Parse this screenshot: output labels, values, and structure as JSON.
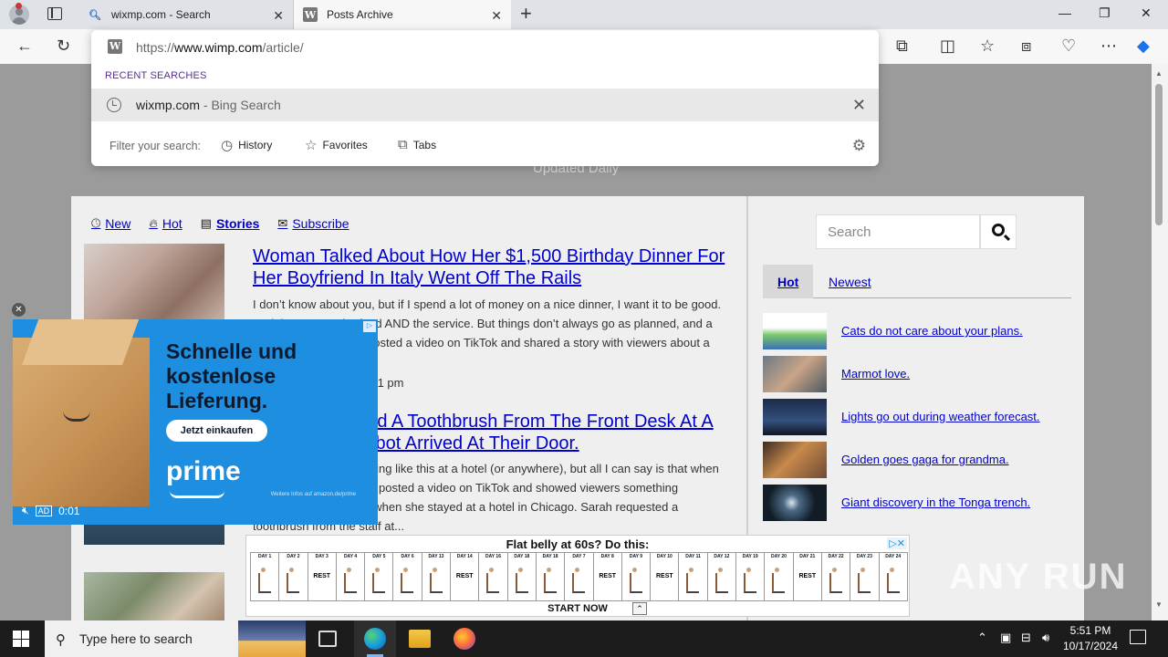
{
  "browser": {
    "tabs": [
      {
        "title": "wixmp.com - Search",
        "favicon": "search-icon"
      },
      {
        "title": "Posts Archive",
        "favicon": "w-logo-icon"
      }
    ],
    "new_tab_symbol": "+",
    "window_controls": [
      "—",
      "❐",
      "✕"
    ]
  },
  "omnibox": {
    "url_prefix": "https://",
    "url_domain": "www.wimp.com",
    "url_path": "/article/",
    "recent_label": "RECENT SEARCHES",
    "recent_item": {
      "query": "wixmp.com",
      "source": " - Bing Search"
    },
    "filter_label": "Filter your search:",
    "filters": [
      {
        "label": "History",
        "icon": "history-icon"
      },
      {
        "label": "Favorites",
        "icon": "star-icon"
      },
      {
        "label": "Tabs",
        "icon": "tabs-icon"
      }
    ]
  },
  "site": {
    "tagline": "Updated Daily",
    "nav": [
      {
        "label": "New",
        "icon": "clock-icon"
      },
      {
        "label": "Hot",
        "icon": "fire-icon"
      },
      {
        "label": "Stories",
        "icon": "newspaper-icon"
      },
      {
        "label": "Subscribe",
        "icon": "envelope-icon"
      }
    ],
    "articles": [
      {
        "title": "Woman Talked About How Her $1,500 Birthday Dinner For Her Boyfriend In Italy Went Off The Rails",
        "excerpt": "I don’t know about you, but if I spend a lot of money on a nice dinner, I want it to be good. And that means the food AND the service. But things don’t always go as planned, and a woman named Kacie posted a video on TikTok and shared a story with viewers about a birthday ...",
        "date": "October 17, 2024 at 1:31 pm"
      },
      {
        "title": "Woman Ordered A Toothbrush From The Front Desk At A Hotel And A Robot Arrived At Their Door.",
        "excerpt": "I’ve never done something like this at a hotel (or anywhere), but all I can say is that when a woman named Sarah posted a video on TikTok and showed viewers something unexpected happened when she stayed at a hotel in Chicago. Sarah requested a toothbrush from the staff at..."
      }
    ]
  },
  "sidebar": {
    "search_placeholder": "Search",
    "tabs": [
      "Hot",
      "Newest"
    ],
    "items": [
      {
        "label": "Cats do not care about your plans."
      },
      {
        "label": "Marmot love."
      },
      {
        "label": "Lights go out during weather forecast."
      },
      {
        "label": "Golden goes gaga for grandma."
      },
      {
        "label": "Giant discovery in the Tonga trench."
      }
    ]
  },
  "video_ad": {
    "headline_1": "Schnelle und",
    "headline_2": "kostenlose",
    "headline_3": "Lieferung.",
    "cta": "Jetzt einkaufen",
    "brand": "prime",
    "fine_print": "Weitere Infos auf amazon.de/prime",
    "ad_badge": "AD",
    "time": "0:01"
  },
  "banner_ad": {
    "title": "Flat belly at 60s? Do this:",
    "cta": "START NOW",
    "days": [
      "DAY 1",
      "DAY 2",
      "DAY 3",
      "DAY 4",
      "DAY 5",
      "DAY 6",
      "DAY 13",
      "DAY 14",
      "DAY 16",
      "DAY 18",
      "DAY 18",
      "DAY 7",
      "DAY 8",
      "DAY 9",
      "DAY 10",
      "DAY 11",
      "DAY 12",
      "DAY 19",
      "DAY 20",
      "DAY 21",
      "DAY 22",
      "DAY 23",
      "DAY 24"
    ],
    "rest_days": [
      2,
      7,
      12,
      14,
      19
    ],
    "rest_label": "REST"
  },
  "watermark": "ANY RUN",
  "taskbar": {
    "search_placeholder": "Type here to search",
    "time": "5:51 PM",
    "date": "10/17/2024"
  }
}
